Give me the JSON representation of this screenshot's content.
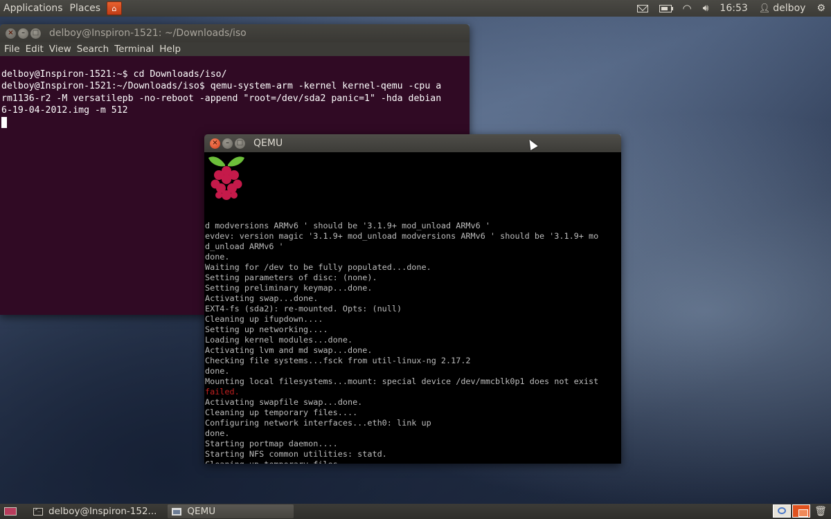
{
  "top_panel": {
    "applications": "Applications",
    "places": "Places",
    "clock": "16:53",
    "user": "delboy",
    "icons": [
      "mail-icon",
      "battery-icon",
      "wifi-icon",
      "volume-icon",
      "user-icon",
      "gear-icon"
    ]
  },
  "terminal": {
    "title": "delboy@Inspiron-1521: ~/Downloads/iso",
    "menu": [
      "File",
      "Edit",
      "View",
      "Search",
      "Terminal",
      "Help"
    ],
    "lines": [
      "delboy@Inspiron-1521:~$ cd Downloads/iso/",
      "delboy@Inspiron-1521:~/Downloads/iso$ qemu-system-arm -kernel kernel-qemu -cpu a",
      "rm1136-r2 -M versatilepb -no-reboot -append \"root=/dev/sda2 panic=1\" -hda debian",
      "6-19-04-2012.img -m 512"
    ],
    "background": "#300a24"
  },
  "qemu": {
    "title": "QEMU",
    "logo": "raspberry-pi-logo",
    "lines": [
      {
        "text": "d modversions ARMv6 ' should be '3.1.9+ mod_unload ARMv6 '"
      },
      {
        "text": "evdev: version magic '3.1.9+ mod_unload modversions ARMv6 ' should be '3.1.9+ mo"
      },
      {
        "text": "d_unload ARMv6 '"
      },
      {
        "text": "done."
      },
      {
        "text": "Waiting for /dev to be fully populated...done."
      },
      {
        "text": "Setting parameters of disc: (none)."
      },
      {
        "text": "Setting preliminary keymap...done."
      },
      {
        "text": "Activating swap...done."
      },
      {
        "text": "EXT4-fs (sda2): re-mounted. Opts: (null)"
      },
      {
        "text": "Cleaning up ifupdown...."
      },
      {
        "text": "Setting up networking...."
      },
      {
        "text": "Loading kernel modules...done."
      },
      {
        "text": "Activating lvm and md swap...done."
      },
      {
        "text": "Checking file systems...fsck from util-linux-ng 2.17.2"
      },
      {
        "text": "done."
      },
      {
        "text": "Mounting local filesystems...mount: special device /dev/mmcblk0p1 does not exist"
      },
      {
        "text": "failed.",
        "fail": true
      },
      {
        "text": "Activating swapfile swap...done."
      },
      {
        "text": "Cleaning up temporary files...."
      },
      {
        "text": "Configuring network interfaces...eth0: link up"
      },
      {
        "text": "done."
      },
      {
        "text": "Starting portmap daemon...."
      },
      {
        "text": "Starting NFS common utilities: statd."
      },
      {
        "text": "Cleaning up temporary files...."
      },
      {
        "text": ""
      },
      {
        "text": "_"
      }
    ]
  },
  "taskbar": {
    "items": [
      {
        "label": "delboy@Inspiron-152...",
        "icon": "terminal-icon"
      },
      {
        "label": "QEMU",
        "icon": "qemu-icon"
      }
    ]
  }
}
